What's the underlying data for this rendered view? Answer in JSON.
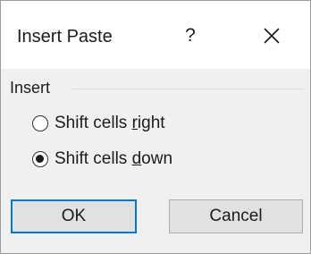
{
  "dialog": {
    "title": "Insert Paste",
    "help_label": "?",
    "close_icon": "close-icon"
  },
  "group": {
    "label": "Insert"
  },
  "options": [
    {
      "prefix": "Shift cells ",
      "accel": "r",
      "suffix": "ight",
      "selected": false
    },
    {
      "prefix": "Shift cells ",
      "accel": "d",
      "suffix": "own",
      "selected": true
    }
  ],
  "buttons": {
    "ok_label": "OK",
    "cancel_label": "Cancel"
  },
  "colors": {
    "focus_border": "#0078d7",
    "dialog_bg": "#f0f0f0",
    "button_bg": "#e1e1e1"
  }
}
